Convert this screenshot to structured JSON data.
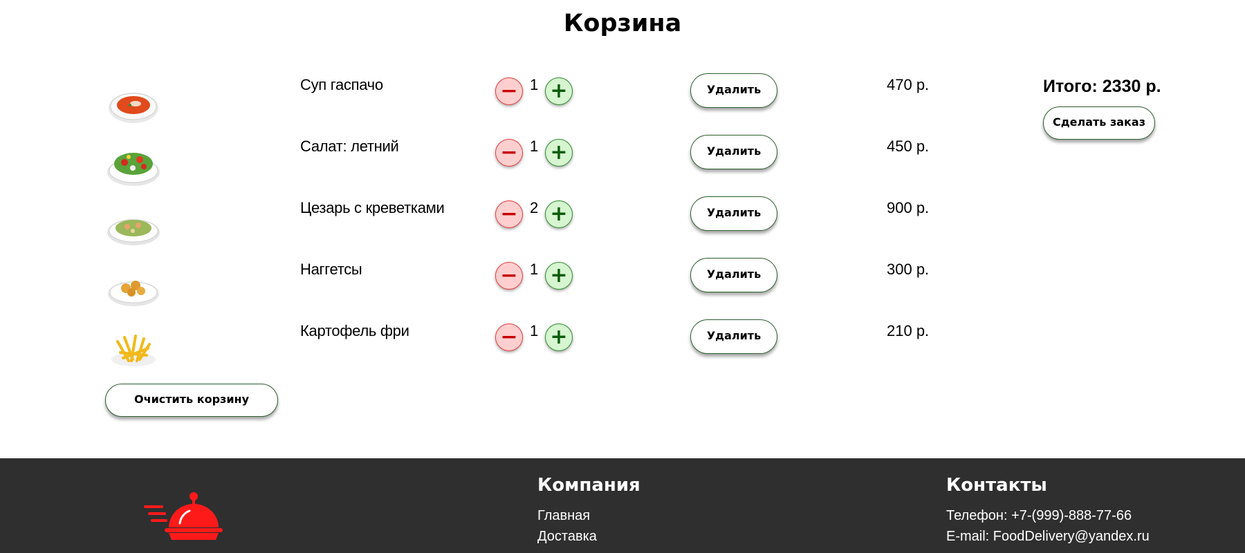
{
  "page": {
    "title": "Корзина"
  },
  "cart": {
    "items": [
      {
        "name": "Суп гаспачо",
        "quantity": "1",
        "price": "470 р.",
        "image": "gazpacho-soup-image",
        "remove_label": "Удалить"
      },
      {
        "name": "Салат: летний",
        "quantity": "1",
        "price": "450 р.",
        "image": "summer-salad-image",
        "remove_label": "Удалить"
      },
      {
        "name": "Цезарь с креветками",
        "quantity": "2",
        "price": "900 р.",
        "image": "caesar-shrimp-salad-image",
        "remove_label": "Удалить"
      },
      {
        "name": "Наггетсы",
        "quantity": "1",
        "price": "300 р.",
        "image": "nuggets-image",
        "remove_label": "Удалить"
      },
      {
        "name": "Картофель фри",
        "quantity": "1",
        "price": "210 р.",
        "image": "french-fries-image",
        "remove_label": "Удалить"
      }
    ],
    "decrease_symbol": "−",
    "increase_symbol": "+",
    "clear_label": "Очистить корзину",
    "total_label": "Итого: 2330 р.",
    "order_label": "Сделать заказ"
  },
  "footer": {
    "logo_icon": "food-delivery-cloche-icon",
    "company": {
      "heading": "Компания",
      "links": [
        "Главная",
        "Доставка"
      ]
    },
    "contacts": {
      "heading": "Контакты",
      "phone": "Телефон: +7-(999)-888-77-66",
      "email": "E-mail: FoodDelivery@yandex.ru"
    }
  },
  "colors": {
    "accent_red": "#e00000",
    "minus_bg": "#ffcfcf",
    "plus_bg": "#d6f5d0",
    "button_border": "#2e5e2e",
    "footer_bg": "#2f2f2f"
  }
}
